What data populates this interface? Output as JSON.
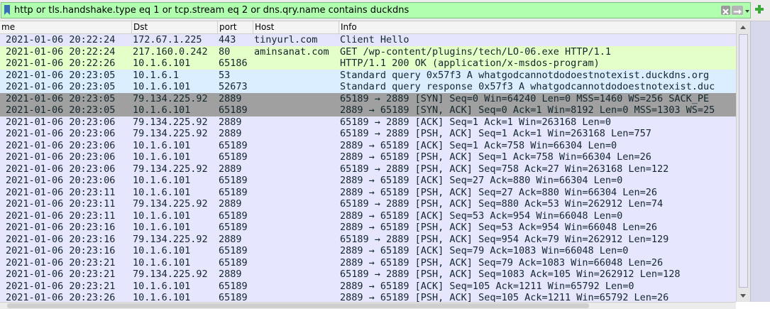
{
  "filter": {
    "value": "http or tls.handshake.type eq 1 or tcp.stream eq 2 or dns.qry.name contains duckdns"
  },
  "columns": [
    {
      "label": "me"
    },
    {
      "label": "Dst"
    },
    {
      "label": "port"
    },
    {
      "label": "Host"
    },
    {
      "label": "Info"
    }
  ],
  "colors": {
    "tls": "#e4e4fc",
    "http": "#e4ffc7",
    "dns": "#daeeff",
    "syn": "#a0a0a0",
    "tcp": "#e7e6ff"
  },
  "rows": [
    {
      "time": "2021-01-06 20:22:24",
      "dst": "172.67.1.225",
      "port": "443",
      "host": "tinyurl.com",
      "info": "Client Hello",
      "color": "#e4e4fc"
    },
    {
      "time": "2021-01-06 20:22:24",
      "dst": "217.160.0.242",
      "port": "80",
      "host": "aminsanat.com",
      "info": "GET /wp-content/plugins/tech/LO-06.exe HTTP/1.1",
      "color": "#e4ffc7"
    },
    {
      "time": "2021-01-06 20:22:26",
      "dst": "10.1.6.101",
      "port": "65186",
      "host": "",
      "info": "HTTP/1.1 200 OK  (application/x-msdos-program)",
      "color": "#e4ffc7"
    },
    {
      "time": "2021-01-06 20:23:05",
      "dst": "10.1.6.1",
      "port": "53",
      "host": "",
      "info": "Standard query 0x57f3 A whatgodcannotdodoestnotexist.duckdns.org",
      "color": "#daeeff"
    },
    {
      "time": "2021-01-06 20:23:05",
      "dst": "10.1.6.101",
      "port": "52673",
      "host": "",
      "info": "Standard query response 0x57f3 A whatgodcannotdodoestnotexist.duc",
      "color": "#daeeff"
    },
    {
      "time": "2021-01-06 20:23:05",
      "dst": "79.134.225.92",
      "port": "2889",
      "host": "",
      "info": "65189 → 2889 [SYN] Seq=0 Win=64240 Len=0 MSS=1460 WS=256 SACK_PE",
      "color": "#a0a0a0"
    },
    {
      "time": "2021-01-06 20:23:05",
      "dst": "10.1.6.101",
      "port": "65189",
      "host": "",
      "info": "2889 → 65189 [SYN, ACK] Seq=0 Ack=1 Win=8192 Len=0 MSS=1303 WS=25",
      "color": "#a0a0a0"
    },
    {
      "time": "2021-01-06 20:23:06",
      "dst": "79.134.225.92",
      "port": "2889",
      "host": "",
      "info": "65189 → 2889 [ACK] Seq=1 Ack=1 Win=263168 Len=0",
      "color": "#e7e6ff"
    },
    {
      "time": "2021-01-06 20:23:06",
      "dst": "79.134.225.92",
      "port": "2889",
      "host": "",
      "info": "65189 → 2889 [PSH, ACK] Seq=1 Ack=1 Win=263168 Len=757",
      "color": "#e7e6ff"
    },
    {
      "time": "2021-01-06 20:23:06",
      "dst": "10.1.6.101",
      "port": "65189",
      "host": "",
      "info": "2889 → 65189 [ACK] Seq=1 Ack=758 Win=66304 Len=0",
      "color": "#e7e6ff"
    },
    {
      "time": "2021-01-06 20:23:06",
      "dst": "10.1.6.101",
      "port": "65189",
      "host": "",
      "info": "2889 → 65189 [PSH, ACK] Seq=1 Ack=758 Win=66304 Len=26",
      "color": "#e7e6ff"
    },
    {
      "time": "2021-01-06 20:23:06",
      "dst": "79.134.225.92",
      "port": "2889",
      "host": "",
      "info": "65189 → 2889 [PSH, ACK] Seq=758 Ack=27 Win=263168 Len=122",
      "color": "#e7e6ff"
    },
    {
      "time": "2021-01-06 20:23:06",
      "dst": "10.1.6.101",
      "port": "65189",
      "host": "",
      "info": "2889 → 65189 [ACK] Seq=27 Ack=880 Win=66304 Len=0",
      "color": "#e7e6ff"
    },
    {
      "time": "2021-01-06 20:23:11",
      "dst": "10.1.6.101",
      "port": "65189",
      "host": "",
      "info": "2889 → 65189 [PSH, ACK] Seq=27 Ack=880 Win=66304 Len=26",
      "color": "#e7e6ff"
    },
    {
      "time": "2021-01-06 20:23:11",
      "dst": "79.134.225.92",
      "port": "2889",
      "host": "",
      "info": "65189 → 2889 [PSH, ACK] Seq=880 Ack=53 Win=262912 Len=74",
      "color": "#e7e6ff"
    },
    {
      "time": "2021-01-06 20:23:11",
      "dst": "10.1.6.101",
      "port": "65189",
      "host": "",
      "info": "2889 → 65189 [ACK] Seq=53 Ack=954 Win=66048 Len=0",
      "color": "#e7e6ff"
    },
    {
      "time": "2021-01-06 20:23:16",
      "dst": "10.1.6.101",
      "port": "65189",
      "host": "",
      "info": "2889 → 65189 [PSH, ACK] Seq=53 Ack=954 Win=66048 Len=26",
      "color": "#e7e6ff"
    },
    {
      "time": "2021-01-06 20:23:16",
      "dst": "79.134.225.92",
      "port": "2889",
      "host": "",
      "info": "65189 → 2889 [PSH, ACK] Seq=954 Ack=79 Win=262912 Len=129",
      "color": "#e7e6ff"
    },
    {
      "time": "2021-01-06 20:23:16",
      "dst": "10.1.6.101",
      "port": "65189",
      "host": "",
      "info": "2889 → 65189 [ACK] Seq=79 Ack=1083 Win=66048 Len=0",
      "color": "#e7e6ff"
    },
    {
      "time": "2021-01-06 20:23:21",
      "dst": "10.1.6.101",
      "port": "65189",
      "host": "",
      "info": "2889 → 65189 [PSH, ACK] Seq=79 Ack=1083 Win=66048 Len=26",
      "color": "#e7e6ff"
    },
    {
      "time": "2021-01-06 20:23:21",
      "dst": "79.134.225.92",
      "port": "2889",
      "host": "",
      "info": "65189 → 2889 [PSH, ACK] Seq=1083 Ack=105 Win=262912 Len=128",
      "color": "#e7e6ff"
    },
    {
      "time": "2021-01-06 20:23:21",
      "dst": "10.1.6.101",
      "port": "65189",
      "host": "",
      "info": "2889 → 65189 [ACK] Seq=105 Ack=1211 Win=65792 Len=0",
      "color": "#e7e6ff"
    },
    {
      "time": "2021-01-06 20:23:26",
      "dst": "10.1.6.101",
      "port": "65189",
      "host": "",
      "info": "2889 → 65189 [PSH, ACK] Seq=105 Ack=1211 Win=65792 Len=26",
      "color": "#e7e6ff"
    }
  ],
  "icons": {
    "bookmark": "bookmark-icon",
    "clear": "clear-icon",
    "apply": "apply-arrow-icon",
    "recent": "chevron-down-icon",
    "add": "plus-icon"
  }
}
